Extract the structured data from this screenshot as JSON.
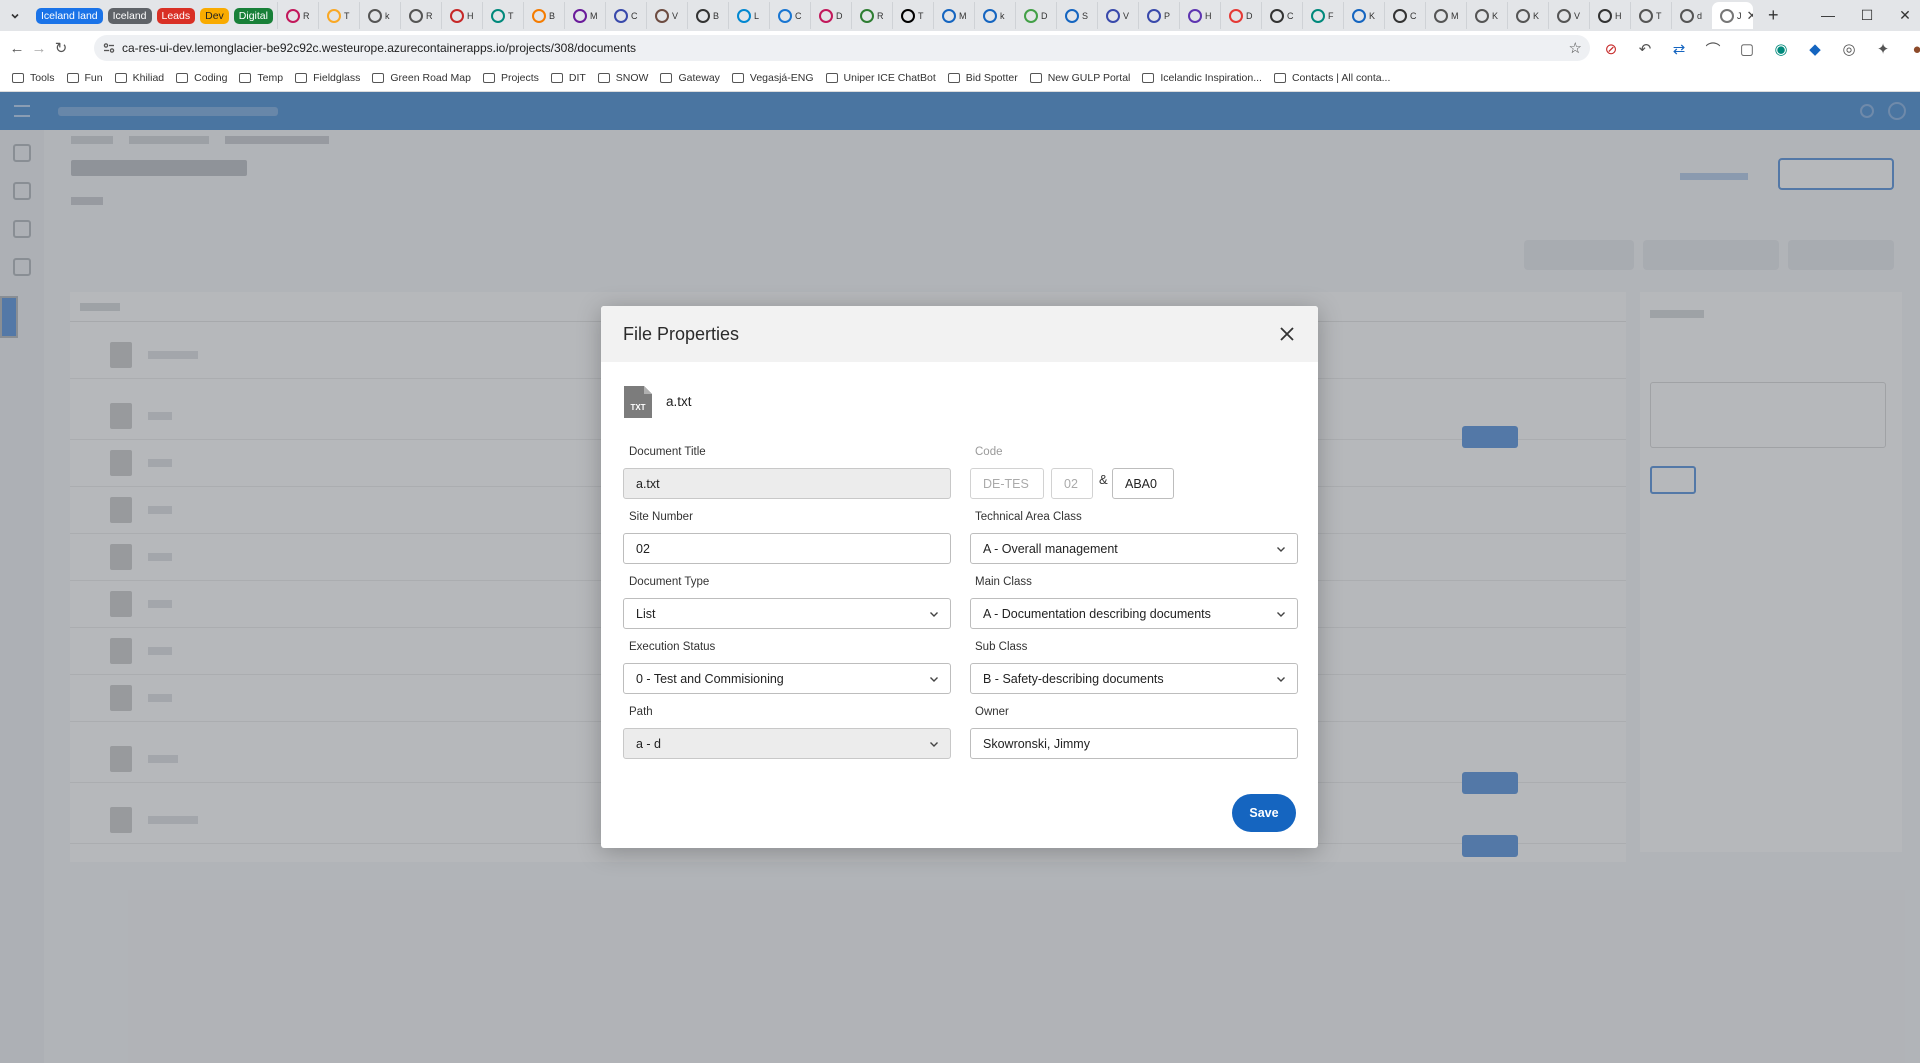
{
  "browser": {
    "tab_groups": [
      {
        "label": "Iceland land",
        "color": "#1a73e8"
      },
      {
        "label": "Iceland",
        "color": "#5f6368"
      },
      {
        "label": "Leads",
        "color": "#d93025"
      },
      {
        "label": "Dev",
        "color": "#f9ab00"
      },
      {
        "label": "Digital",
        "color": "#188038"
      }
    ],
    "tabs": [
      {
        "label": "R"
      },
      {
        "label": "T"
      },
      {
        "label": "k"
      },
      {
        "label": "R"
      },
      {
        "label": "H"
      },
      {
        "label": "T"
      },
      {
        "label": "B"
      },
      {
        "label": "M"
      },
      {
        "label": "C"
      },
      {
        "label": "V"
      },
      {
        "label": "B"
      },
      {
        "label": "L"
      },
      {
        "label": "C"
      },
      {
        "label": "D"
      },
      {
        "label": "R"
      },
      {
        "label": "T"
      },
      {
        "label": "M"
      },
      {
        "label": "k"
      },
      {
        "label": "D"
      },
      {
        "label": "S"
      },
      {
        "label": "V"
      },
      {
        "label": "P"
      },
      {
        "label": "H"
      },
      {
        "label": "D"
      },
      {
        "label": "C"
      },
      {
        "label": "F"
      },
      {
        "label": "K"
      },
      {
        "label": "C"
      },
      {
        "label": "M"
      },
      {
        "label": "K"
      },
      {
        "label": "K"
      },
      {
        "label": "V"
      },
      {
        "label": "H"
      },
      {
        "label": "T"
      },
      {
        "label": "d"
      }
    ],
    "active_tab": {
      "label": "J"
    },
    "url": "ca-res-ui-dev.lemonglacier-be92c92c.westeurope.azurecontainerapps.io/projects/308/documents",
    "bookmarks": [
      "Tools",
      "Fun",
      "Khiliad",
      "Coding",
      "Temp",
      "Fieldglass",
      "Green Road Map",
      "Projects",
      "DIT",
      "SNOW",
      "Gateway",
      "Vegasjá-ENG",
      "Uniper ICE ChatBot",
      "Bid Spotter",
      "New GULP Portal",
      "Icelandic Inspiration...",
      "Contacts | All conta..."
    ]
  },
  "modal": {
    "title": "File Properties",
    "file_name": "a.txt",
    "file_icon_label": "TXT",
    "labels": {
      "document_title": "Document Title",
      "code": "Code",
      "site_number": "Site Number",
      "technical_area_class": "Technical Area Class",
      "document_type": "Document Type",
      "main_class": "Main Class",
      "execution_status": "Execution Status",
      "sub_class": "Sub Class",
      "path": "Path",
      "owner": "Owner"
    },
    "values": {
      "document_title": "a.txt",
      "code_part1": "DE-TES",
      "code_part2": "02",
      "code_separator": "&",
      "code_part3": "ABA0",
      "site_number": "02",
      "technical_area_class": "A - Overall management",
      "document_type": "List",
      "main_class": "A - Documentation describing documents",
      "execution_status": "0 - Test and Commisioning",
      "sub_class": "B - Safety-describing documents",
      "path": "a - d",
      "owner": "Skowronski, Jimmy"
    },
    "save_label": "Save"
  }
}
